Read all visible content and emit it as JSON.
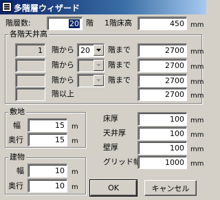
{
  "window": {
    "title": "多階層ウィザード"
  },
  "top": {
    "floors_label": "階層数:",
    "floors_value": "20",
    "floors_unit": "階",
    "first_floor_height_label": "1階床高",
    "first_floor_height_value": "450",
    "first_floor_height_unit": "mm"
  },
  "ceiling": {
    "group_title": "各階天井高",
    "rows": [
      {
        "from_value": "1",
        "from_label": "階から",
        "to_value": "20",
        "to_label": "階まで",
        "height": "2700",
        "unit": "mm"
      },
      {
        "from_value": "",
        "from_label": "階から",
        "to_value": "",
        "to_label": "階まで",
        "height": "2700",
        "unit": "mm"
      },
      {
        "from_value": "",
        "from_label": "階から",
        "to_value": "",
        "to_label": "階まで",
        "height": "2700",
        "unit": "mm"
      },
      {
        "from_value": "",
        "from_label": "階以上",
        "height": "2700",
        "unit": "mm"
      }
    ]
  },
  "site": {
    "group_title": "敷地",
    "width_label": "幅",
    "width_value": "15",
    "width_unit": "m",
    "depth_label": "奥行",
    "depth_value": "15",
    "depth_unit": "m"
  },
  "building": {
    "group_title": "建物",
    "width_label": "幅",
    "width_value": "10",
    "width_unit": "m",
    "depth_label": "奥行",
    "depth_value": "10",
    "depth_unit": "m"
  },
  "thickness": [
    {
      "label": "床厚",
      "value": "100",
      "unit": "mm"
    },
    {
      "label": "天井厚",
      "value": "100",
      "unit": "mm"
    },
    {
      "label": "壁厚",
      "value": "100",
      "unit": "mm"
    },
    {
      "label": "グリッド幅",
      "value": "1000",
      "unit": "mm"
    }
  ],
  "buttons": {
    "ok": "OK",
    "cancel": "キャンセル"
  }
}
